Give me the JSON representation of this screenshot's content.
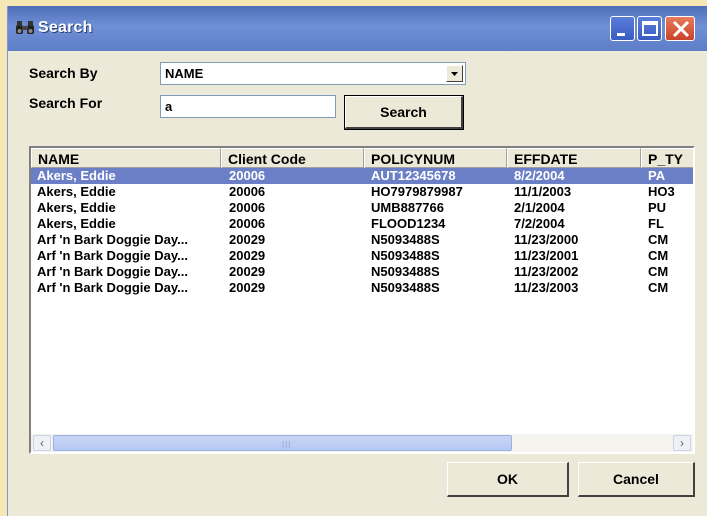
{
  "window": {
    "title": "Search",
    "icons": {
      "app": "binoculars-icon",
      "minimize": "minimize-icon",
      "maximize": "maximize-icon",
      "close": "close-icon"
    }
  },
  "form": {
    "search_by_label": "Search By",
    "search_by_value": "NAME",
    "search_for_label": "Search For",
    "search_for_value": "a",
    "search_button": "Search"
  },
  "table": {
    "columns": [
      "NAME",
      "Client Code",
      "POLICYNUM",
      "EFFDATE",
      "P_TY"
    ],
    "rows": [
      [
        "Akers, Eddie",
        "20006",
        "AUT12345678",
        "8/2/2004",
        "PA"
      ],
      [
        "Akers, Eddie",
        "20006",
        "HO7979879987",
        "11/1/2003",
        "HO3"
      ],
      [
        "Akers, Eddie",
        "20006",
        "UMB887766",
        "2/1/2004",
        "PU"
      ],
      [
        "Akers, Eddie",
        "20006",
        "FLOOD1234",
        "7/2/2004",
        "FL"
      ],
      [
        "Arf 'n Bark Doggie Day...",
        "20029",
        "N5093488S",
        "11/23/2000",
        "CM"
      ],
      [
        "Arf 'n Bark Doggie Day...",
        "20029",
        "N5093488S",
        "11/23/2001",
        "CM"
      ],
      [
        "Arf 'n Bark Doggie Day...",
        "20029",
        "N5093488S",
        "11/23/2002",
        "CM"
      ],
      [
        "Arf 'n Bark Doggie Day...",
        "20029",
        "N5093488S",
        "11/23/2003",
        "CM"
      ]
    ],
    "selected_row": 0,
    "scrollbar": {
      "left_arrow": "‹",
      "right_arrow": "›",
      "grip": "|||"
    }
  },
  "buttons": {
    "ok": "OK",
    "cancel": "Cancel"
  },
  "colors": {
    "titlebar": "#5d7ec8",
    "selection": "#6b7fc6",
    "dialog_bg": "#ece9d8",
    "close_button": "#d9553a"
  }
}
